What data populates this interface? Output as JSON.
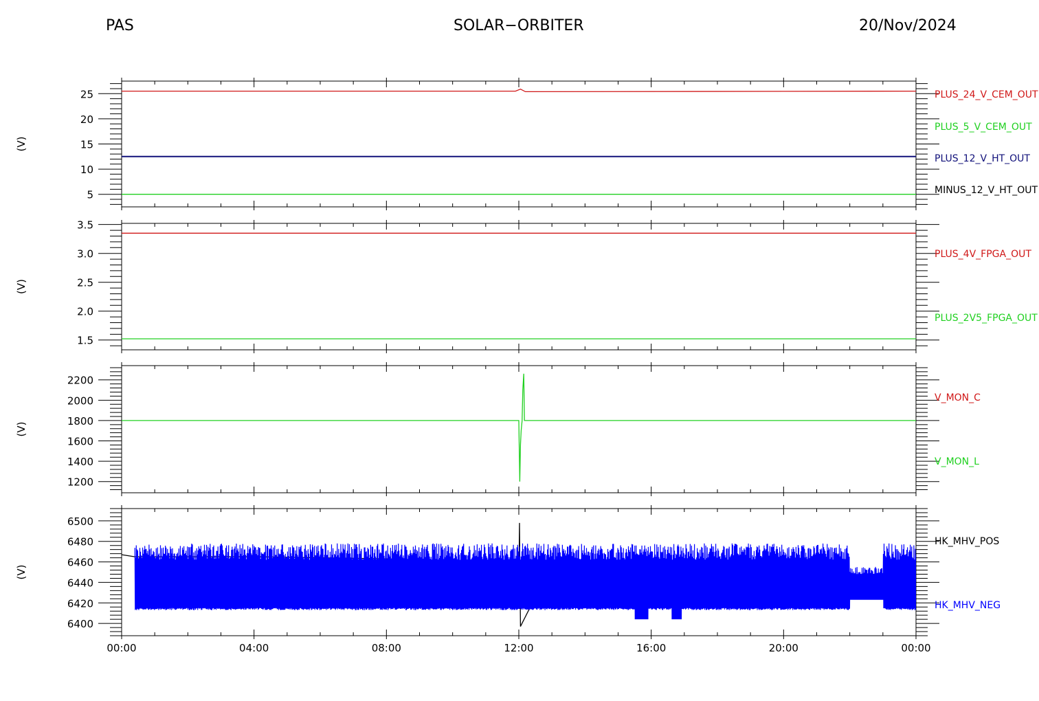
{
  "header": {
    "left": "PAS",
    "center": "SOLAR−ORBITER",
    "right": "20/Nov/2024"
  },
  "x_axis": {
    "tick_labels": [
      "00:00",
      "04:00",
      "08:00",
      "12:00",
      "16:00",
      "20:00",
      "00:00"
    ]
  },
  "colors": {
    "red": "#d01818",
    "green": "#20d020",
    "navy": "#10107a",
    "blue": "#0000ff",
    "black": "#000000"
  },
  "chart_data": [
    {
      "type": "line",
      "ylabel": "(V)",
      "ylim": [
        2.5,
        27.5
      ],
      "y_ticks": [
        5,
        10,
        15,
        20,
        25
      ],
      "x_hours": [
        0,
        24
      ],
      "series": [
        {
          "name": "PLUS_24_V_CEM_OUT",
          "color_key": "red",
          "x": [
            0,
            11.9,
            12.05,
            12.2,
            24
          ],
          "y": [
            25.5,
            25.5,
            25.9,
            25.4,
            25.5
          ]
        },
        {
          "name": "PLUS_5_V_CEM_OUT",
          "color_key": "green",
          "x": [
            0,
            24
          ],
          "y": [
            5.0,
            5.0
          ]
        },
        {
          "name": "PLUS_12_V_HT_OUT",
          "color_key": "navy",
          "x": [
            0,
            24
          ],
          "y": [
            12.5,
            12.5
          ]
        },
        {
          "name": "MINUS_12_V_HT_OUT",
          "color_key": "black",
          "x": [],
          "y": []
        }
      ]
    },
    {
      "type": "line",
      "ylabel": "(V)",
      "ylim": [
        1.33,
        3.52
      ],
      "y_ticks": [
        1.5,
        2.0,
        2.5,
        3.0,
        3.5
      ],
      "x_hours": [
        0,
        24
      ],
      "series": [
        {
          "name": "PLUS_4V_FPGA_OUT",
          "color_key": "red",
          "x": [
            0,
            24
          ],
          "y": [
            3.35,
            3.35
          ]
        },
        {
          "name": "PLUS_2V5_FPGA_OUT",
          "color_key": "green",
          "x": [
            0,
            24
          ],
          "y": [
            1.52,
            1.52
          ]
        }
      ]
    },
    {
      "type": "line",
      "ylabel": "(V)",
      "ylim": [
        1090,
        2340
      ],
      "y_ticks": [
        1200,
        1400,
        1600,
        1800,
        2000,
        2200
      ],
      "x_hours": [
        0,
        24
      ],
      "series": [
        {
          "name": "V_MON_C",
          "color_key": "red",
          "x": [],
          "y": []
        },
        {
          "name": "V_MON_L",
          "color_key": "green",
          "x": [
            0,
            12.0,
            12.03,
            12.05,
            12.07,
            12.1,
            12.12,
            12.15,
            12.17,
            12.2,
            12.22,
            24
          ],
          "y": [
            1800,
            1800,
            1200,
            1560,
            1700,
            1800,
            2100,
            2260,
            1800,
            1800,
            1800,
            1800
          ]
        }
      ]
    },
    {
      "type": "line",
      "ylabel": "(V)",
      "ylim": [
        6388,
        6512
      ],
      "y_ticks": [
        6400,
        6420,
        6440,
        6460,
        6480,
        6500
      ],
      "x_hours": [
        0,
        24
      ],
      "series": [
        {
          "name": "HK_MHV_POS",
          "color_key": "black",
          "x": [
            0,
            0.4,
            2,
            4,
            6,
            8,
            9,
            10,
            12,
            12.02,
            12.05,
            13,
            14,
            15,
            15.6,
            16,
            16.5,
            17,
            18,
            19,
            20,
            21,
            21.4,
            22,
            23,
            24
          ],
          "y": [
            6467,
            6465,
            6465,
            6465,
            6464,
            6463,
            6462,
            6458,
            6440,
            6498,
            6397,
            6458,
            6458,
            6455,
            6437,
            6438,
            6436,
            6440,
            6455,
            6458,
            6457,
            6457,
            6443,
            6443,
            6442,
            6442
          ]
        },
        {
          "name": "HK_MHV_NEG",
          "color_key": "blue",
          "x": [
            0.4,
            24
          ],
          "y": [
            6413,
            6465
          ]
        }
      ]
    }
  ]
}
